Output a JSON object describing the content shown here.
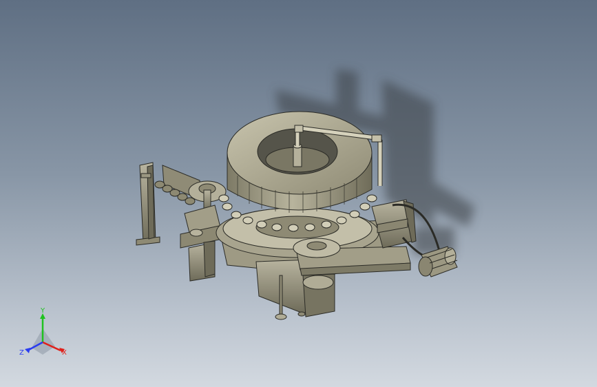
{
  "viewport": {
    "background_top": "#5f6f83",
    "background_bottom": "#d3d9e0",
    "model_color": "#a9a58e",
    "model_edge": "#2b2b26",
    "shadow_color": "#3a3f45"
  },
  "triad": {
    "x_label": "X",
    "y_label": "Y",
    "z_label": "Z",
    "x_color": "#e0201a",
    "y_color": "#1fc21f",
    "z_color": "#2a3cf0"
  }
}
